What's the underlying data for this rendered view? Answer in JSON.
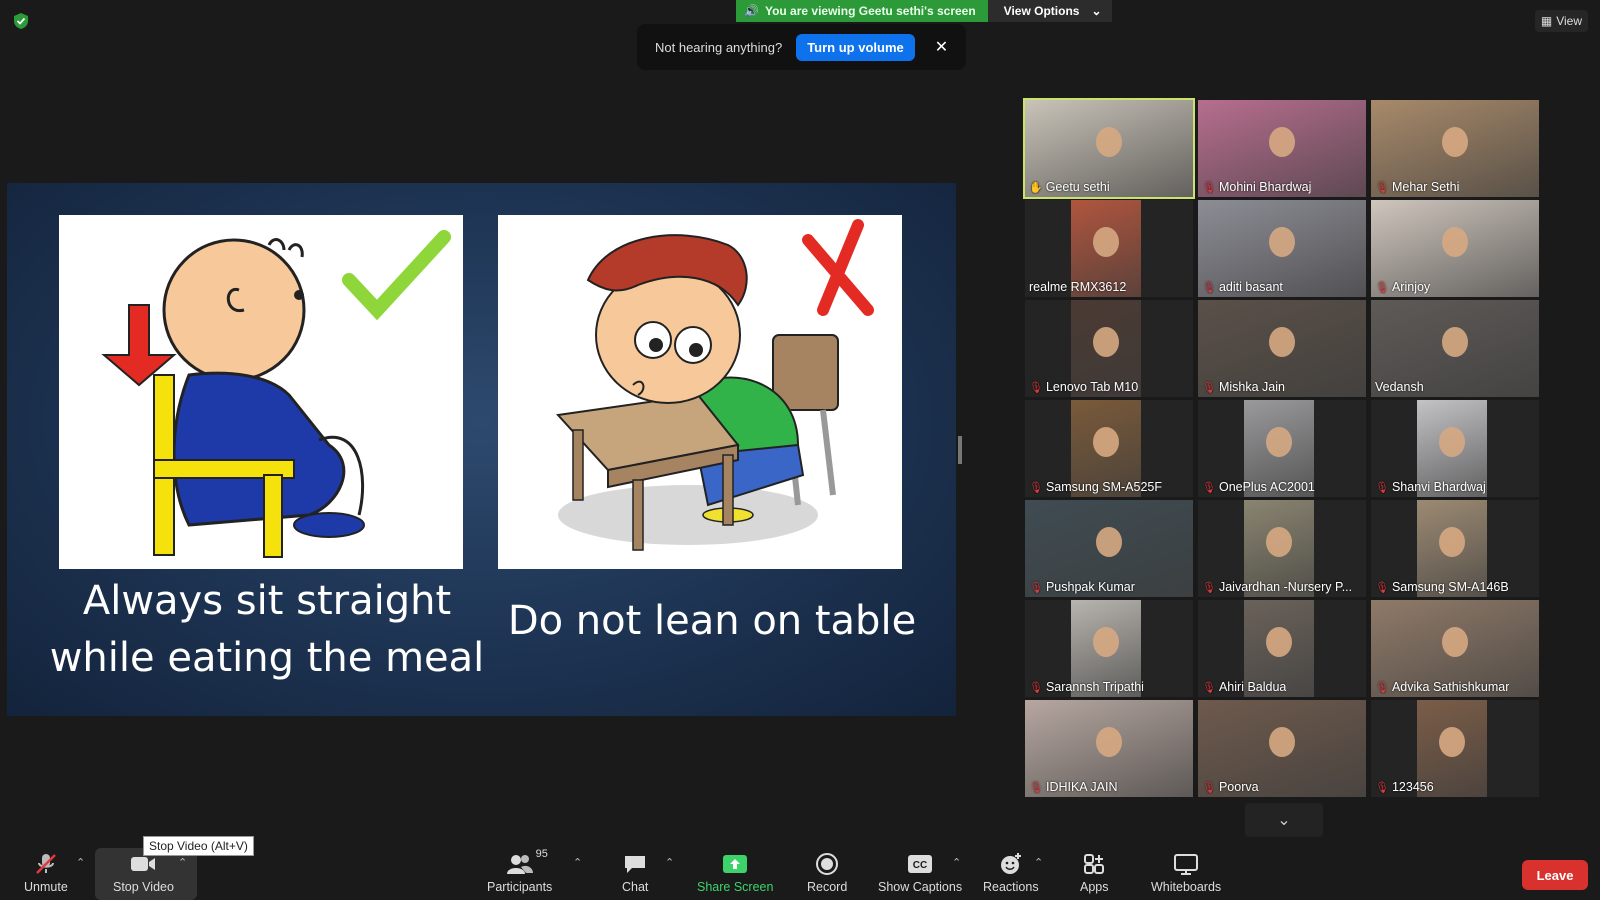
{
  "banner": {
    "viewing_text": "You are viewing Geetu sethi's screen",
    "view_options": "View Options",
    "view_button": "View"
  },
  "toast": {
    "message": "Not hearing anything?",
    "button": "Turn up volume",
    "close": "✕"
  },
  "slide": {
    "left_caption_line1": "Always sit straight",
    "left_caption_line2": "while eating the meal",
    "right_caption": "Do not lean on table"
  },
  "participants_tiles": [
    {
      "name": "Geetu sethi",
      "bg": "#c9c3b8",
      "pinned": true
    },
    {
      "name": "Mohini Bhardwaj",
      "bg": "#b76e8f"
    },
    {
      "name": "Mehar Sethi",
      "bg": "#a88a6a"
    },
    {
      "name": "realme RMX3612",
      "bg": "#b0553e"
    },
    {
      "name": "aditi basant",
      "bg": "#8d8d96"
    },
    {
      "name": "Arinjoy",
      "bg": "#cfc6bd"
    },
    {
      "name": "Lenovo Tab M10",
      "bg": "#4b3a33"
    },
    {
      "name": "Mishka Jain",
      "bg": "#5a5048"
    },
    {
      "name": "Vedansh",
      "bg": "#5e5a57"
    },
    {
      "name": "Samsung SM-A525F",
      "bg": "#7a5a3a"
    },
    {
      "name": "OnePlus AC2001",
      "bg": "#9a9a9c"
    },
    {
      "name": "Shanvi Bhardwaj",
      "bg": "#c3c3c6"
    },
    {
      "name": "Pushpak Kumar",
      "bg": "#3f4c52"
    },
    {
      "name": "Jaivardhan -Nursery P...",
      "bg": "#8a8470"
    },
    {
      "name": "Samsung SM-A146B",
      "bg": "#9c8a73"
    },
    {
      "name": "Sarannsh Tripathi",
      "bg": "#b8b4ae"
    },
    {
      "name": "Ahiri Baldua",
      "bg": "#6a625a"
    },
    {
      "name": "Advika Sathishkumar",
      "bg": "#8f7a68"
    },
    {
      "name": "IDHIKA JAIN",
      "bg": "#b6a7a0"
    },
    {
      "name": "Poorva",
      "bg": "#6e5a4d"
    },
    {
      "name": "123456",
      "bg": "#7b5d48"
    }
  ],
  "toolbar": {
    "unmute": "Unmute",
    "stop_video": "Stop Video",
    "tooltip": "Stop Video (Alt+V)",
    "participants": "Participants",
    "participants_count": "95",
    "chat": "Chat",
    "share_screen": "Share Screen",
    "record": "Record",
    "show_captions": "Show Captions",
    "reactions": "Reactions",
    "apps": "Apps",
    "whiteboards": "Whiteboards",
    "leave": "Leave"
  },
  "colors": {
    "accent_green": "#2d9a3a",
    "share_blue": "#0e72ed",
    "leave_red": "#d9312e",
    "active_outline": "#c9e36b"
  }
}
